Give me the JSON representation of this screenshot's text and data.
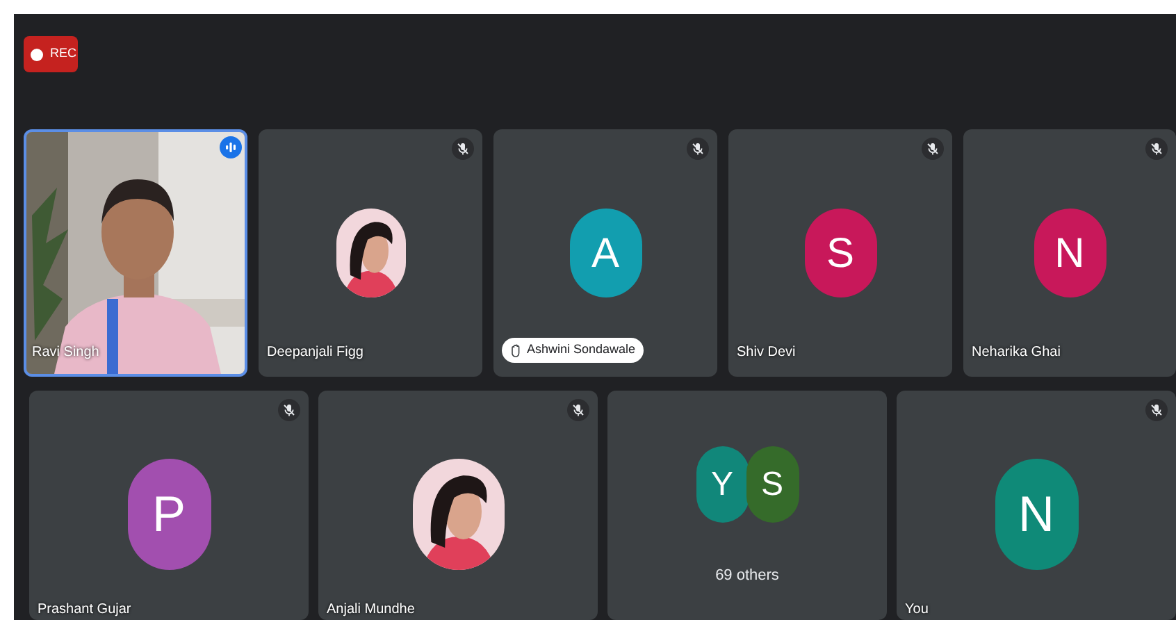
{
  "recording": {
    "label": "REC"
  },
  "rows": [
    {
      "tiles": [
        {
          "kind": "video",
          "name": "Ravi Singh",
          "selected": true,
          "speaking": true,
          "muted": false,
          "hand_raised": false
        },
        {
          "name": "Deepanjali Figg",
          "selected": false,
          "speaking": false,
          "muted": true,
          "hand_raised": false
        },
        {
          "kind": "initial",
          "name": "Ashwini Sondawale",
          "initial": "A",
          "color": "#129eaf",
          "selected": false,
          "speaking": false,
          "muted": true,
          "hand_raised": true
        },
        {
          "kind": "initial",
          "name": "Shiv Devi",
          "initial": "S",
          "color": "#c8185a",
          "selected": false,
          "speaking": false,
          "muted": true,
          "hand_raised": false
        },
        {
          "kind": "initial",
          "name": "Neharika Ghai",
          "initial": "N",
          "color": "#c8185a",
          "selected": false,
          "speaking": false,
          "muted": true,
          "hand_raised": false
        }
      ]
    },
    {
      "tiles": [
        {
          "kind": "initial",
          "name": "Prashant Gujar",
          "initial": "P",
          "color": "#a24faf",
          "selected": false,
          "speaking": false,
          "muted": true,
          "hand_raised": false
        },
        {
          "name": "Anjali Mundhe",
          "selected": false,
          "speaking": false,
          "muted": true,
          "hand_raised": false
        },
        {
          "kind": "others",
          "label": "69 others",
          "avatars": [
            {
              "initial": "Y",
              "color": "#11877a"
            },
            {
              "initial": "S",
              "color": "#356b2a"
            }
          ],
          "selected": false,
          "speaking": false,
          "muted": false,
          "hand_raised": false
        },
        {
          "kind": "initial",
          "name": "You",
          "initial": "N",
          "color": "#0f8a78",
          "selected": false,
          "speaking": false,
          "muted": true,
          "hand_raised": false
        }
      ]
    }
  ]
}
